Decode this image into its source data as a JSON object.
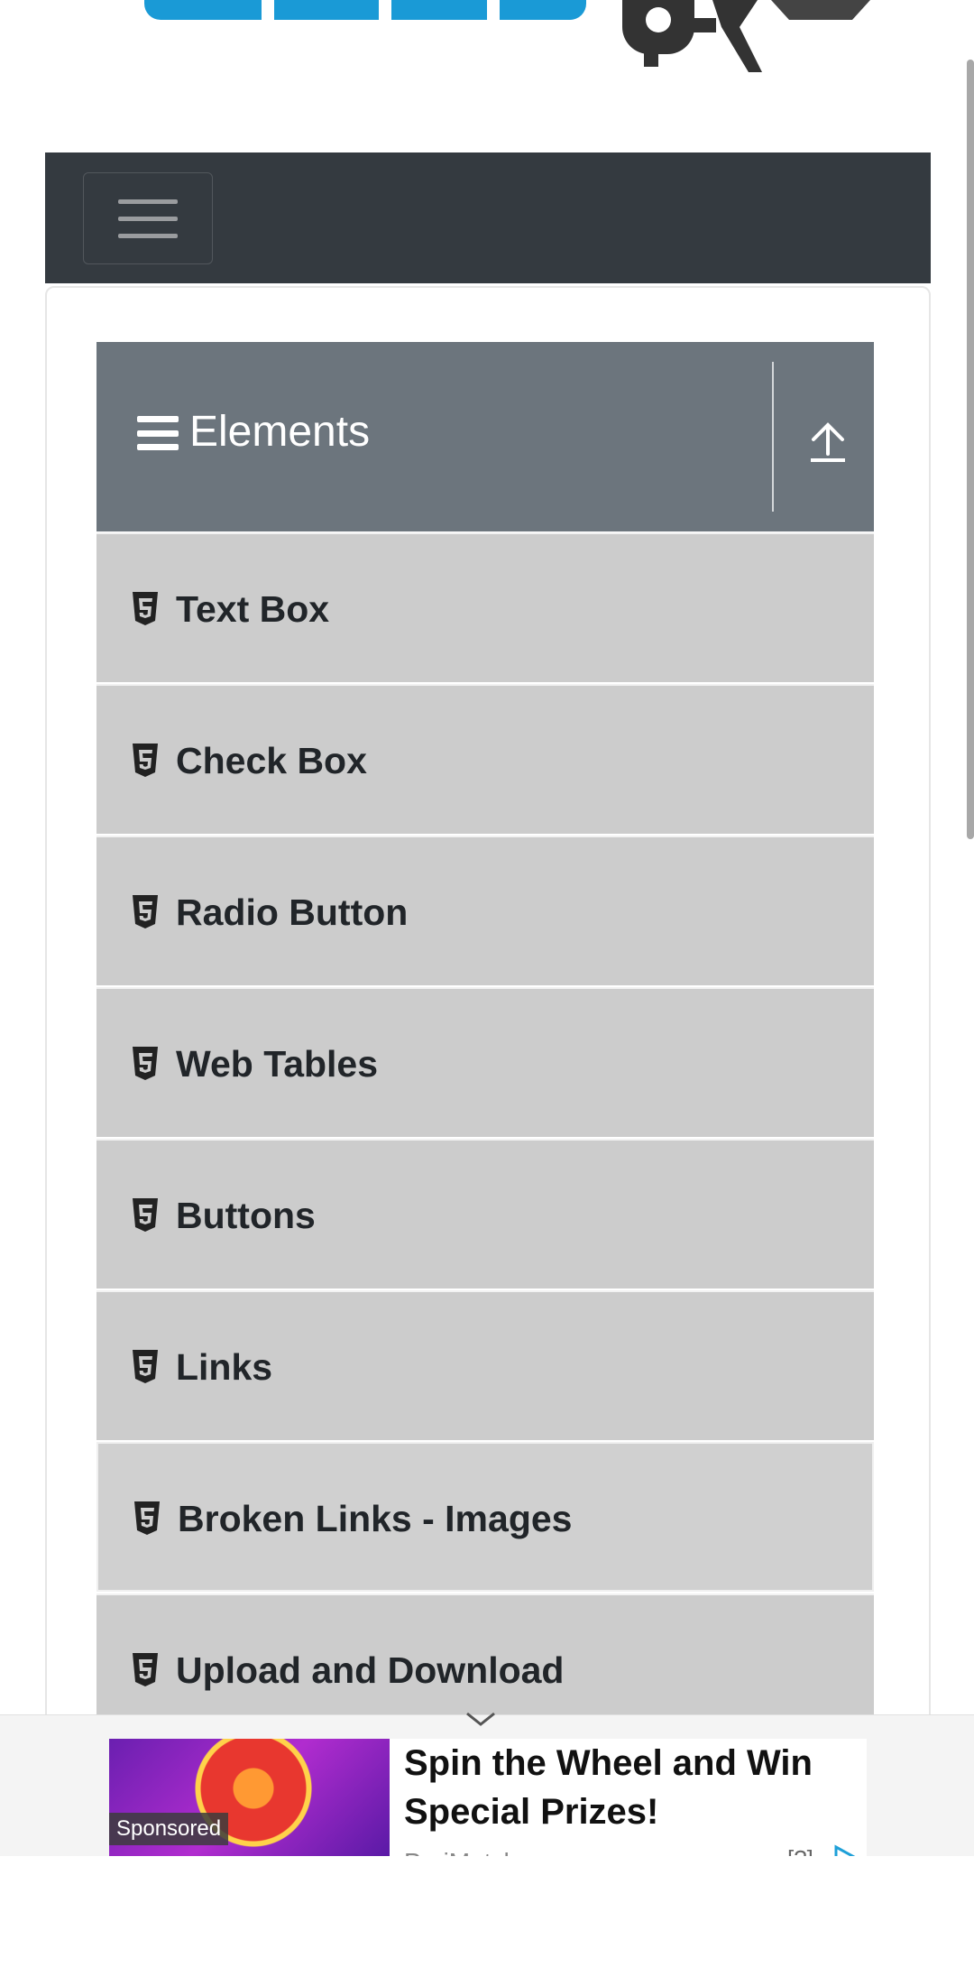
{
  "header": {
    "logo_alt": "ToolsQA"
  },
  "navbar": {
    "toggler_icon": "hamburger-icon"
  },
  "sidebar": {
    "group": {
      "title": "Elements",
      "icon": "menu-icon",
      "collapse_icon": "upload-icon"
    },
    "items": [
      {
        "label": "Text Box"
      },
      {
        "label": "Check Box"
      },
      {
        "label": "Radio Button"
      },
      {
        "label": "Web Tables"
      },
      {
        "label": "Buttons"
      },
      {
        "label": "Links"
      },
      {
        "label": "Broken Links - Images"
      },
      {
        "label": "Upload and Download"
      }
    ]
  },
  "ad": {
    "sponsored_label": "Sponsored",
    "headline": "Spin the Wheel and Win Special Prizes!",
    "advertiser": "PariMatch",
    "info_label": "[?]"
  },
  "colors": {
    "navbar": "#343a40",
    "group_header": "#6c757d",
    "menu_item": "#cccccc",
    "logo_blue": "#1a9ad6"
  }
}
